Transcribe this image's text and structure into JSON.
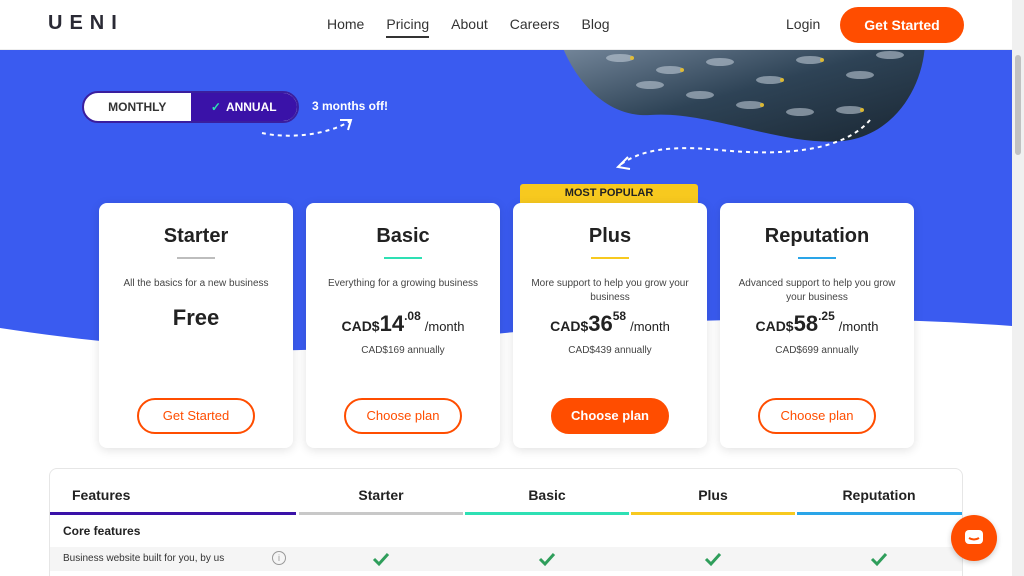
{
  "nav": {
    "logo": "UENI",
    "links": [
      "Home",
      "Pricing",
      "About",
      "Careers",
      "Blog"
    ],
    "active": "Pricing",
    "login": "Login",
    "cta": "Get Started"
  },
  "toggle": {
    "monthly": "MONTHLY",
    "annual": "ANNUAL",
    "promo": "3 months off!"
  },
  "plans": [
    {
      "name": "Starter",
      "desc": "All the basics for a new business",
      "price_label": "Free",
      "button": "Get Started",
      "rule_color": "#bdbdbd"
    },
    {
      "name": "Basic",
      "desc": "Everything for a growing business",
      "currency": "CAD$",
      "price_main": "14",
      "price_cents": ".08",
      "period": "/month",
      "annual": "CAD$169 annually",
      "button": "Choose plan",
      "rule_color": "#2ee0b4"
    },
    {
      "name": "Plus",
      "desc": "More support to help you grow your business",
      "currency": "CAD$",
      "price_main": "36",
      "price_cents": "58",
      "period": "/month",
      "annual": "CAD$439 annually",
      "button": "Choose plan",
      "badge": "MOST POPULAR",
      "rule_color": "#f7c91f"
    },
    {
      "name": "Reputation",
      "desc": "Advanced support to help you grow your business",
      "currency": "CAD$",
      "price_main": "58",
      "price_cents": ".25",
      "period": "/month",
      "annual": "CAD$699 annually",
      "button": "Choose plan",
      "rule_color": "#2aa5e8"
    }
  ],
  "features": {
    "header": "Features",
    "columns": [
      "Starter",
      "Basic",
      "Plus",
      "Reputation"
    ],
    "section": "Core features",
    "rows": [
      {
        "label": "Business website built for you, by us",
        "values": [
          true,
          true,
          true,
          true
        ]
      }
    ]
  },
  "colors": {
    "accent": "#ff4d00",
    "hero_blue": "#3a5bf0",
    "toggle_purple": "#3a12a8",
    "check_green": "#2f9e5b"
  }
}
